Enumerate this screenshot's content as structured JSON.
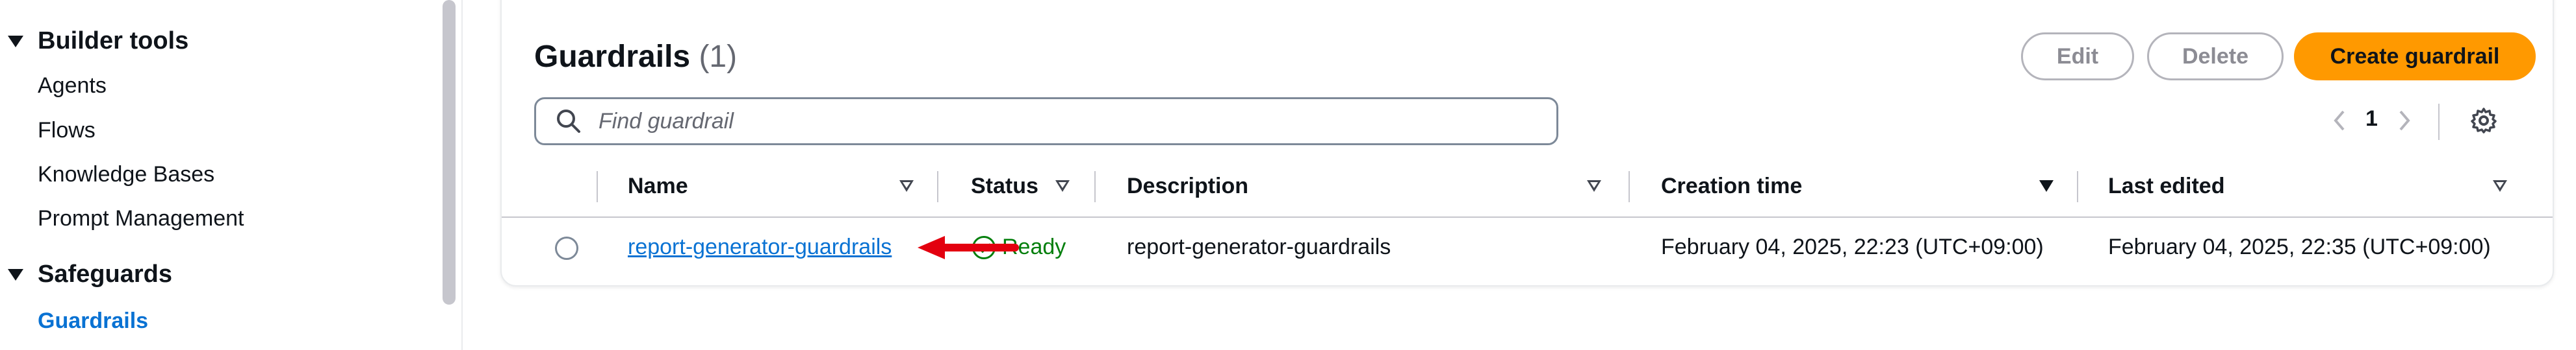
{
  "sidebar": {
    "builder_tools": {
      "title": "Builder tools",
      "items": [
        {
          "label": "Agents"
        },
        {
          "label": "Flows"
        },
        {
          "label": "Knowledge Bases"
        },
        {
          "label": "Prompt Management"
        }
      ]
    },
    "safeguards": {
      "title": "Safeguards",
      "items": [
        {
          "label": "Guardrails",
          "active": true
        }
      ]
    }
  },
  "header": {
    "title": "Guardrails",
    "count": "(1)"
  },
  "actions": {
    "edit": "Edit",
    "delete": "Delete",
    "create": "Create guardrail"
  },
  "search": {
    "placeholder": "Find guardrail",
    "value": ""
  },
  "pagination": {
    "current_page": "1"
  },
  "table": {
    "columns": [
      "Name",
      "Status",
      "Description",
      "Creation time",
      "Last edited"
    ],
    "rows": [
      {
        "name": "report-generator-guardrails",
        "status": "Ready",
        "description": "report-generator-guardrails",
        "creation_time": "February 04, 2025, 22:23 (UTC+09:00)",
        "last_edited": "February 04, 2025, 22:35 (UTC+09:00)"
      }
    ]
  },
  "colors": {
    "primary": "#ff9900",
    "link": "#0972d3",
    "success": "#037f0c",
    "annotation_arrow": "#e3000f"
  }
}
